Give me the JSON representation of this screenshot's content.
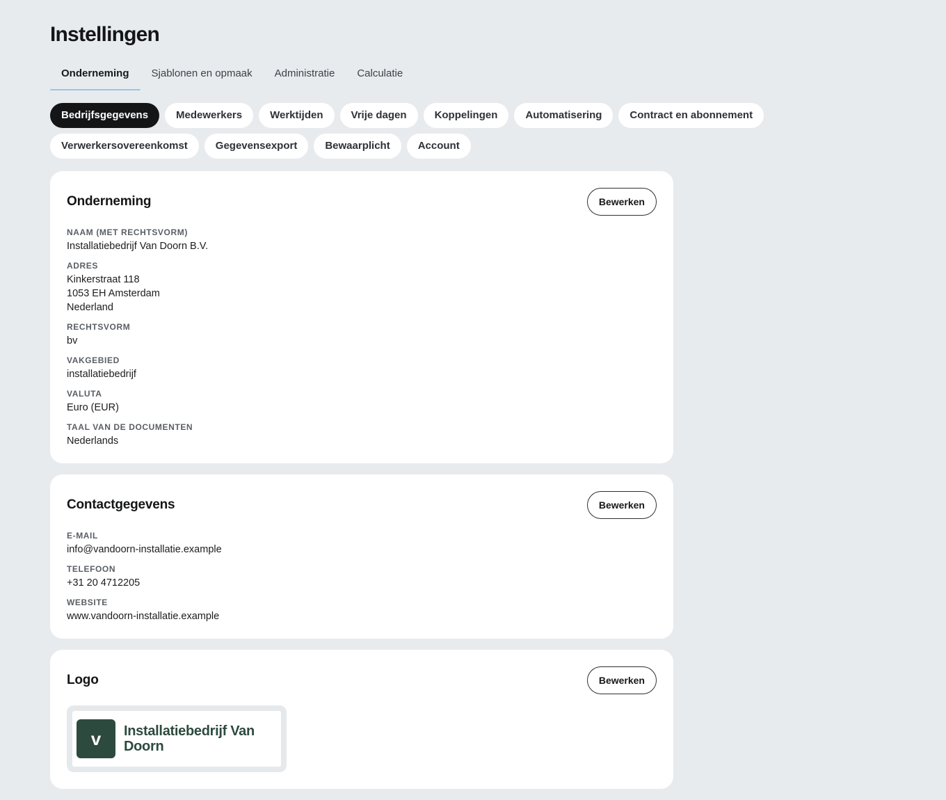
{
  "page": {
    "title": "Instellingen"
  },
  "tabs": [
    {
      "label": "Onderneming",
      "active": true
    },
    {
      "label": "Sjablonen en opmaak",
      "active": false
    },
    {
      "label": "Administratie",
      "active": false
    },
    {
      "label": "Calculatie",
      "active": false
    }
  ],
  "chips": [
    {
      "label": "Bedrijfsgegevens",
      "active": true
    },
    {
      "label": "Medewerkers"
    },
    {
      "label": "Werktijden"
    },
    {
      "label": "Vrije dagen"
    },
    {
      "label": "Koppelingen"
    },
    {
      "label": "Automatisering"
    },
    {
      "label": "Contract en abonnement"
    },
    {
      "label": "Verwerkersovereenkomst"
    },
    {
      "label": "Gegevensexport"
    },
    {
      "label": "Bewaarplicht"
    },
    {
      "label": "Account"
    }
  ],
  "company": {
    "title": "Onderneming",
    "edit_label": "Bewerken",
    "name_label": "Naam (met rechtsvorm)",
    "name": "Installatiebedrijf Van Doorn B.V.",
    "address_label": "Adres",
    "address_line1": "Kinkerstraat 118",
    "address_line2": "1053 EH Amsterdam",
    "address_line3": "Nederland",
    "legal_form_label": "Rechtsvorm",
    "legal_form": "bv",
    "field_label": "Vakgebied",
    "field": "installatiebedrijf",
    "currency_label": "Valuta",
    "currency": "Euro (EUR)",
    "doc_language_label": "Taal van de documenten",
    "doc_language": "Nederlands"
  },
  "contact": {
    "title": "Contactgegevens",
    "edit_label": "Bewerken",
    "email_label": "E-mail",
    "email": "info@vandoorn-installatie.example",
    "phone_label": "Telefoon",
    "phone": "+31 20 4712205",
    "website_label": "Website",
    "website": "www.vandoorn-installatie.example"
  },
  "logo": {
    "title": "Logo",
    "edit_label": "Bewerken",
    "mark": "v",
    "text": "Installatiebedrijf Van Doorn",
    "brand_color": "#2d4a3e"
  }
}
